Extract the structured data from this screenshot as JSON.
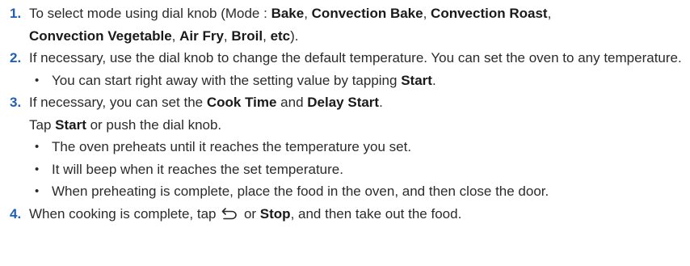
{
  "steps": [
    {
      "number": "1.",
      "p1": "To select mode using dial knob (Mode : ",
      "bake": "Bake",
      "sep1": ", ",
      "convection_bake": "Convection Bake",
      "sep2": ", ",
      "convection_roast": "Convection Roast",
      "sep3": ",",
      "convection_vegetable": "Convection Vegetable",
      "sep4": ", ",
      "air_fry": "Air Fry",
      "sep5": ", ",
      "broil": "Broil",
      "sep6": ", ",
      "etc": "etc",
      "end": ")."
    },
    {
      "number": "2.",
      "text": "If necessary, use the dial knob to change the default temperature. You can set the oven to any temperature.",
      "bullet": {
        "text": "You can start right away with the setting value by tapping ",
        "start": "Start",
        "end": "."
      }
    },
    {
      "number": "3.",
      "p1": "If necessary, you can set the ",
      "cook_time": "Cook Time",
      "and": " and ",
      "delay_start": "Delay Start",
      "end": ".",
      "line2_pre": "Tap ",
      "line2_start": "Start",
      "line2_post": " or push the dial knob.",
      "bullets": [
        "The oven preheats until it reaches the temperature you set.",
        "It will beep when it reaches the set temperature.",
        "When preheating is complete, place the food in the oven, and then close the door."
      ]
    },
    {
      "number": "4.",
      "p1": "When cooking is complete, tap ",
      "icon": "back-arrow-icon",
      "or": " or ",
      "stop": "Stop",
      "end": ", and then take out the food."
    }
  ],
  "bullet_char": "•",
  "colors": {
    "number": "#1f5fb4",
    "text": "#2b2b2b"
  }
}
